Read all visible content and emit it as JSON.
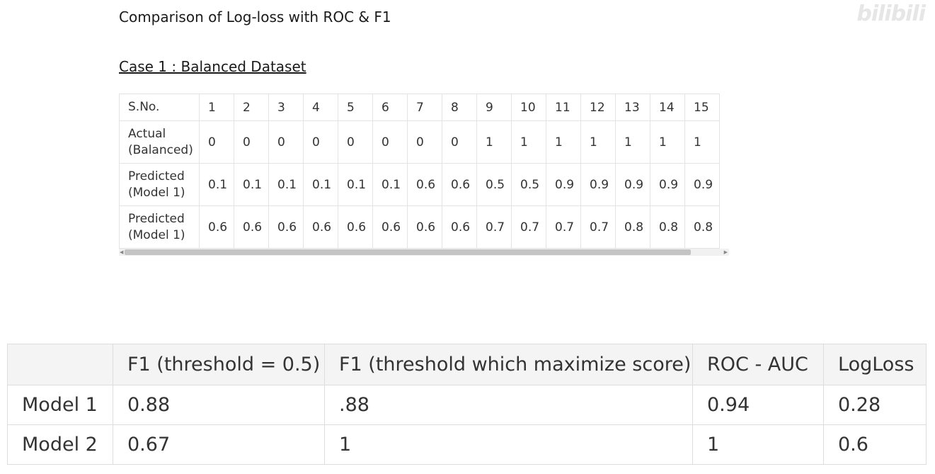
{
  "page": {
    "title": "Comparison of Log-loss with ROC & F1",
    "section_heading": "Case 1 : Balanced Dataset",
    "watermark": "bilibili"
  },
  "data_table": {
    "header_label": "S.No.",
    "columns": [
      "1",
      "2",
      "3",
      "4",
      "5",
      "6",
      "7",
      "8",
      "9",
      "10",
      "11",
      "12",
      "13",
      "14",
      "15"
    ],
    "rows": [
      {
        "label_line1": "Actual",
        "label_line2": "(Balanced)",
        "values": [
          "0",
          "0",
          "0",
          "0",
          "0",
          "0",
          "0",
          "0",
          "1",
          "1",
          "1",
          "1",
          "1",
          "1",
          "1"
        ]
      },
      {
        "label_line1": "Predicted",
        "label_line2": "(Model 1)",
        "values": [
          "0.1",
          "0.1",
          "0.1",
          "0.1",
          "0.1",
          "0.1",
          "0.6",
          "0.6",
          "0.5",
          "0.5",
          "0.9",
          "0.9",
          "0.9",
          "0.9",
          "0.9"
        ]
      },
      {
        "label_line1": "Predicted",
        "label_line2": "(Model 1)",
        "values": [
          "0.6",
          "0.6",
          "0.6",
          "0.6",
          "0.6",
          "0.6",
          "0.6",
          "0.6",
          "0.7",
          "0.7",
          "0.7",
          "0.7",
          "0.8",
          "0.8",
          "0.8"
        ]
      }
    ]
  },
  "metrics_table": {
    "headers": [
      "",
      "F1 (threshold = 0.5)",
      "F1 (threshold which maximize score)",
      "ROC - AUC",
      "LogLoss"
    ],
    "rows": [
      [
        "Model 1",
        "0.88",
        ".88",
        "0.94",
        "0.28"
      ],
      [
        "Model 2",
        "0.67",
        "1",
        "1",
        "0.6"
      ]
    ]
  }
}
